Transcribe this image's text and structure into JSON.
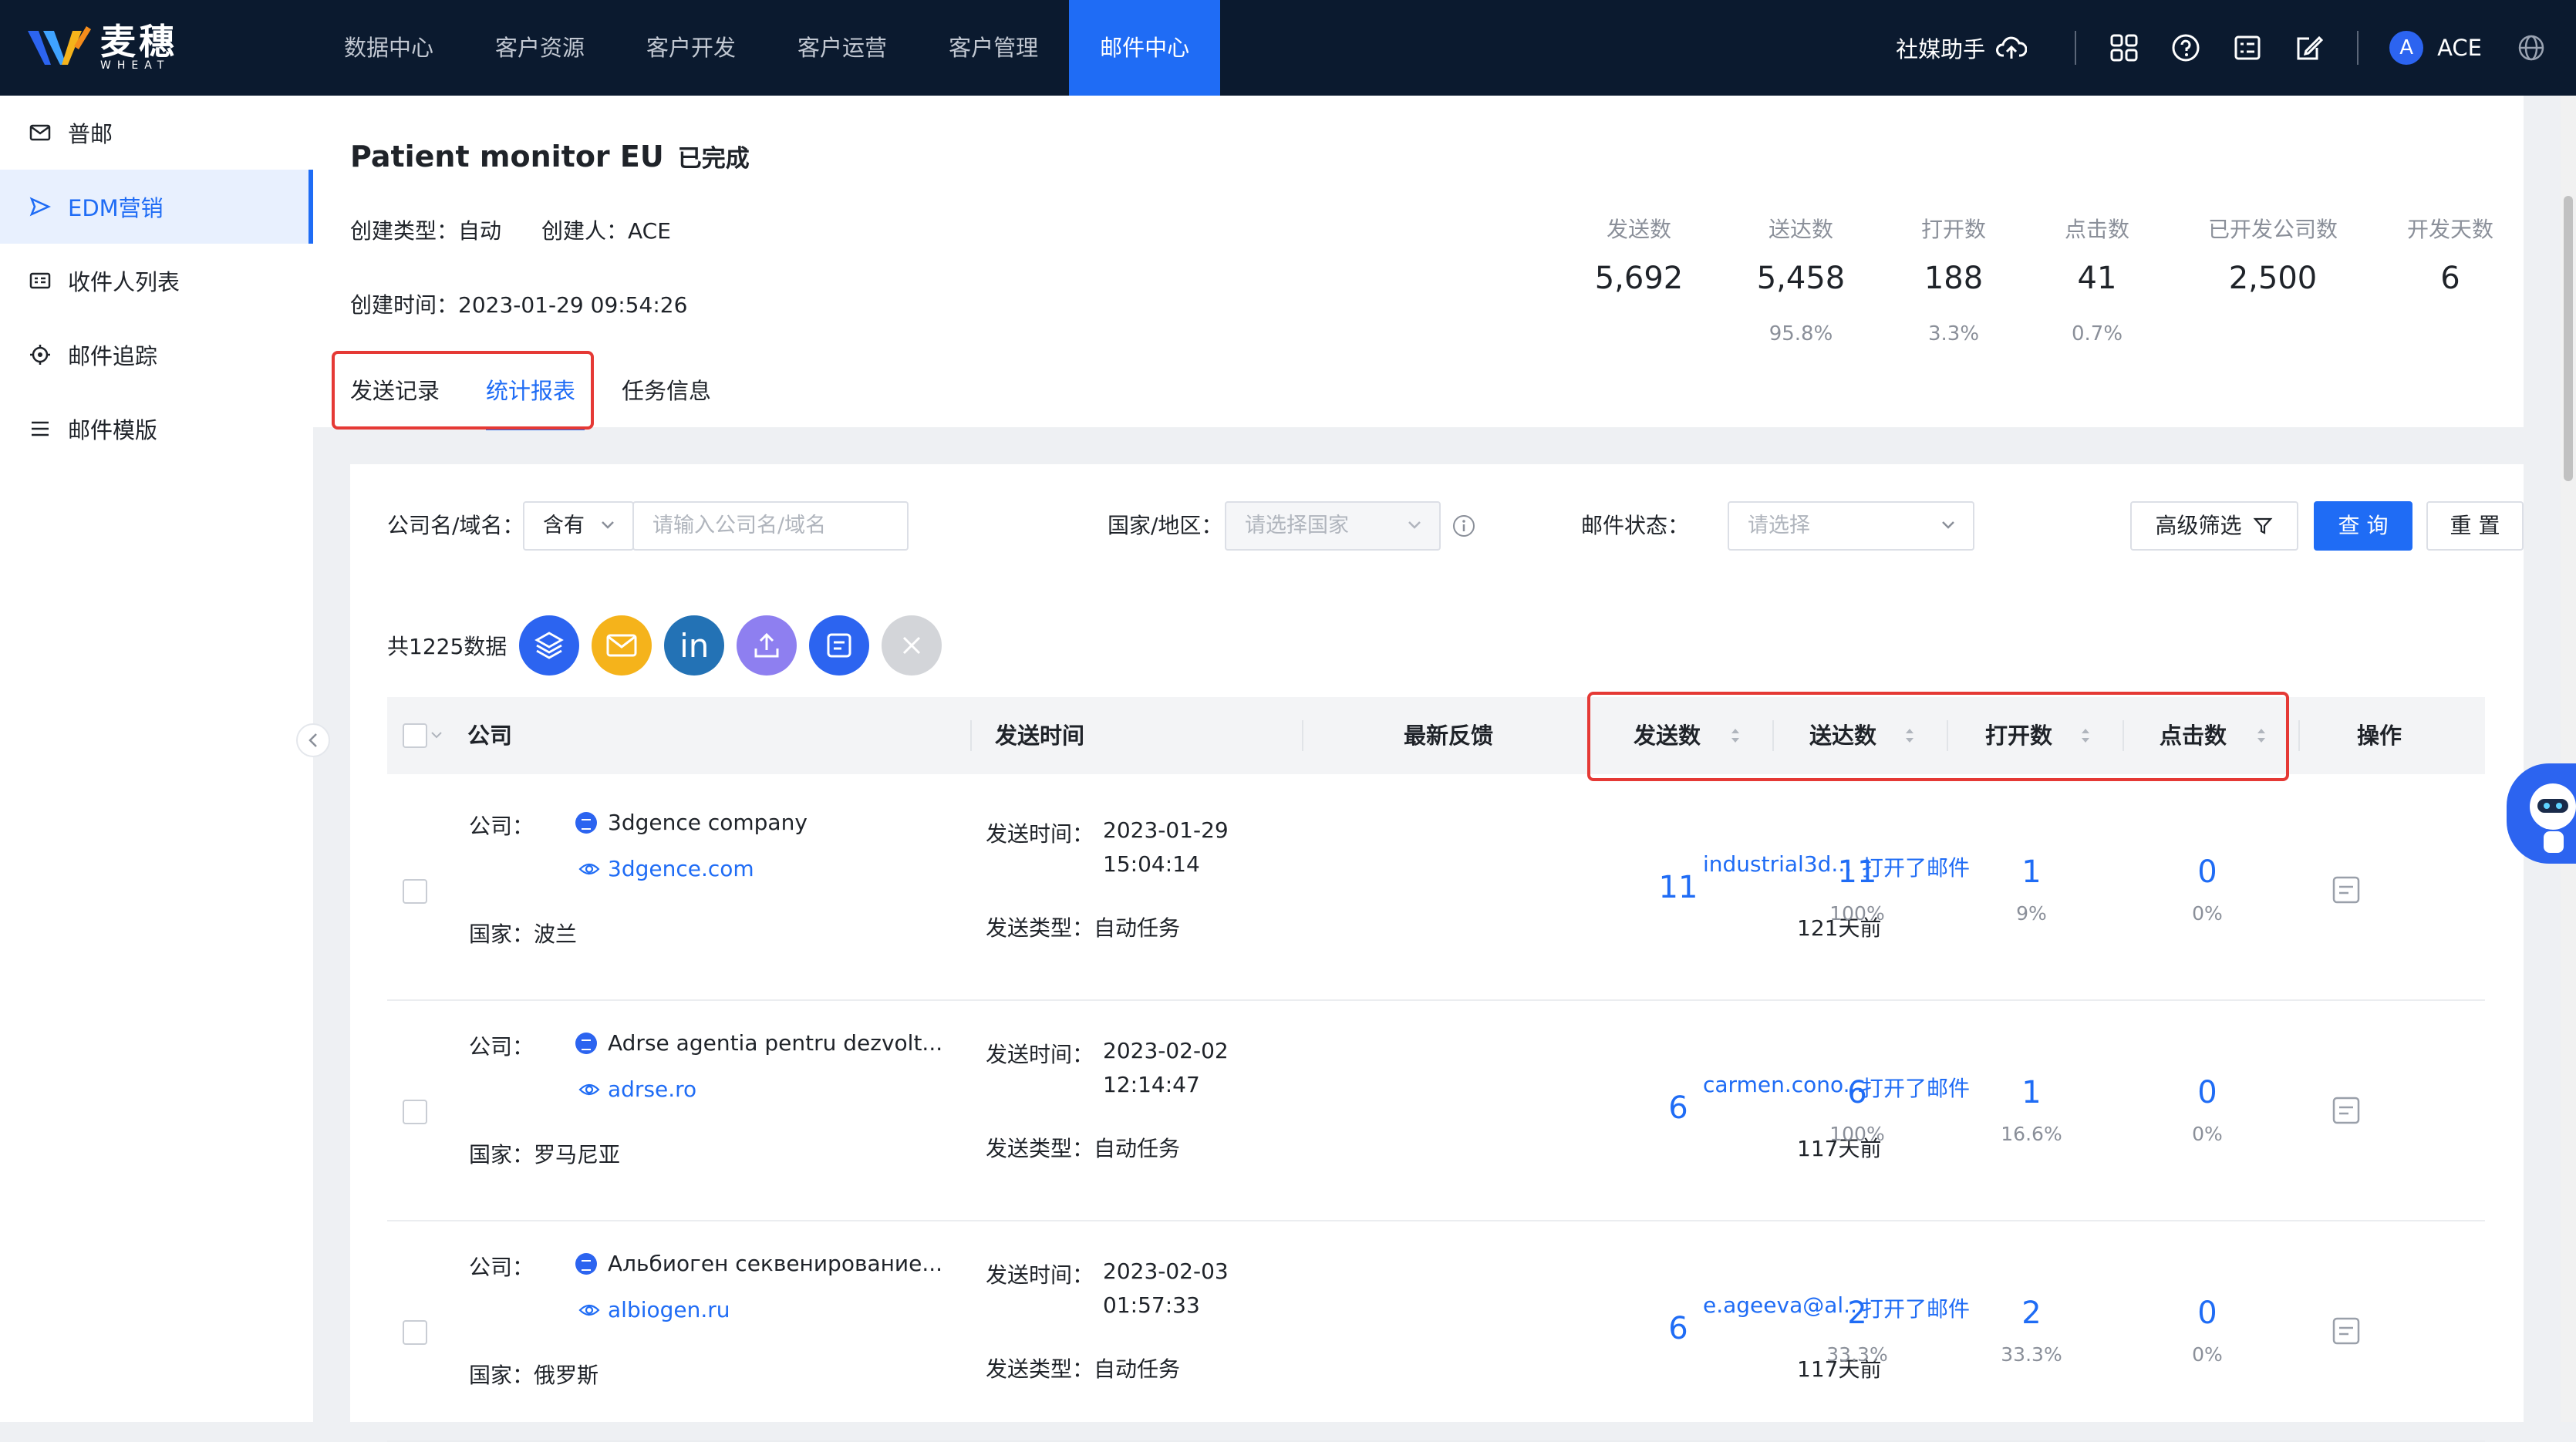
{
  "brand": {
    "name": "麦穗",
    "sub": "WHEAT"
  },
  "nav": {
    "items": [
      "数据中心",
      "客户资源",
      "客户开发",
      "客户运营",
      "客户管理",
      "邮件中心"
    ],
    "active": "邮件中心"
  },
  "topright": {
    "social": "社媒助手",
    "avatar_letter": "A",
    "user": "ACE"
  },
  "sidebar": {
    "items": [
      "普邮",
      "EDM营销",
      "收件人列表",
      "邮件追踪",
      "邮件模版"
    ],
    "active": "EDM营销"
  },
  "header": {
    "title": "Patient monitor EU",
    "status": "已完成",
    "create_type": "创建类型：自动",
    "creator": "创建人：ACE",
    "create_time": "创建时间：2023-01-29 09:54:26"
  },
  "stats": [
    {
      "label": "发送数",
      "value": "5,692",
      "pct": ""
    },
    {
      "label": "送达数",
      "value": "5,458",
      "pct": "95.8%"
    },
    {
      "label": "打开数",
      "value": "188",
      "pct": "3.3%"
    },
    {
      "label": "点击数",
      "value": "41",
      "pct": "0.7%"
    },
    {
      "label": "已开发公司数",
      "value": "2,500",
      "pct": ""
    },
    {
      "label": "开发天数",
      "value": "6",
      "pct": ""
    }
  ],
  "tabs": [
    "发送记录",
    "统计报表",
    "任务信息"
  ],
  "active_tab": "统计报表",
  "filters": {
    "company_label": "公司名/域名：",
    "match_value": "含有",
    "company_placeholder": "请输入公司名/域名",
    "country_label": "国家/地区：",
    "country_placeholder": "请选择国家",
    "status_label": "邮件状态：",
    "status_placeholder": "请选择",
    "advanced": "高级筛选",
    "query": "查 询",
    "reset": "重 置"
  },
  "total": "共1225数据",
  "table": {
    "columns": {
      "company": "公司",
      "send_time": "发送时间",
      "feedback": "最新反馈",
      "sent": "发送数",
      "delivered": "送达数",
      "opened": "打开数",
      "clicked": "点击数",
      "action": "操作"
    },
    "labels": {
      "company": "公司：",
      "country": "国家：",
      "send_time": "发送时间：",
      "send_type": "发送类型："
    },
    "rows": [
      {
        "company": "3dgence company",
        "domain": "3dgence.com",
        "country": "波兰",
        "date": "2023-01-29",
        "time": "15:04:14",
        "type": "自动任务",
        "email": "industrial3d...",
        "feedback": "打开了邮件",
        "days": "121天前",
        "sent": "11",
        "delivered": "11",
        "delivered_pct": "100%",
        "opened": "1",
        "opened_pct": "9%",
        "clicked": "0",
        "clicked_pct": "0%"
      },
      {
        "company": "Adrse agentia pentru dezvolt...",
        "domain": "adrse.ro",
        "country": "罗马尼亚",
        "date": "2023-02-02",
        "time": "12:14:47",
        "type": "自动任务",
        "email": "carmen.cono...",
        "feedback": "打开了邮件",
        "days": "117天前",
        "sent": "6",
        "delivered": "6",
        "delivered_pct": "100%",
        "opened": "1",
        "opened_pct": "16.6%",
        "clicked": "0",
        "clicked_pct": "0%"
      },
      {
        "company": "Альбиоген секвенирование...",
        "domain": "albiogen.ru",
        "country": "俄罗斯",
        "date": "2023-02-03",
        "time": "01:57:33",
        "type": "自动任务",
        "email": "e.ageeva@al...",
        "feedback": "打开了邮件",
        "days": "117天前",
        "sent": "6",
        "delivered": "2",
        "delivered_pct": "33.3%",
        "opened": "2",
        "opened_pct": "33.3%",
        "clicked": "0",
        "clicked_pct": "0%"
      }
    ]
  }
}
